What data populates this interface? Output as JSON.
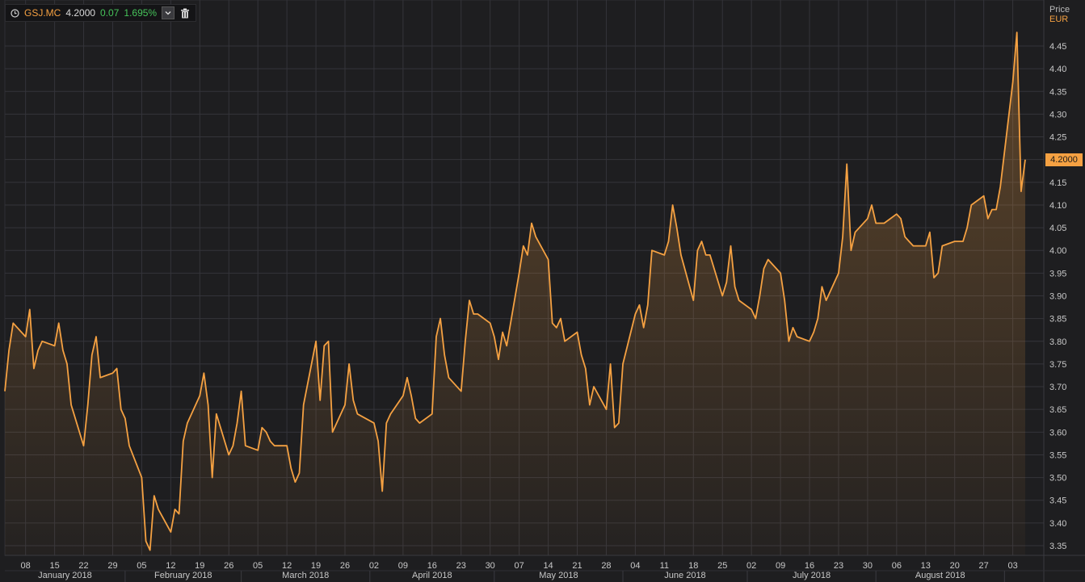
{
  "header": {
    "ticker": "GSJ.MC",
    "price": "4.2000",
    "change": "0.07",
    "change_pct": "1.695%"
  },
  "axis": {
    "price_title": "Price",
    "currency": "EUR",
    "last_price_tag": "4.2000"
  },
  "colors": {
    "background": "#1e1e20",
    "grid": "#34343a",
    "line": "#f5a142",
    "positive": "#46c45a",
    "axis_text": "#c8c8c8"
  },
  "icons": {
    "clock": "clock-icon",
    "dropdown": "chevron-down-icon",
    "delete": "trash-icon"
  },
  "chart_data": {
    "type": "area",
    "title": "",
    "xlabel": "",
    "ylabel": "Price",
    "unit": "EUR",
    "ylim": [
      3.33,
      4.5
    ],
    "yticks": [
      "3.35",
      "3.40",
      "3.45",
      "3.50",
      "3.55",
      "3.60",
      "3.65",
      "3.70",
      "3.75",
      "3.80",
      "3.85",
      "3.90",
      "3.95",
      "4.00",
      "4.05",
      "4.10",
      "4.15",
      "4.20",
      "4.25",
      "4.30",
      "4.35",
      "4.40",
      "4.45"
    ],
    "xlim": [
      "2018-01-03",
      "2018-08-07"
    ],
    "grid": true,
    "x_tick_labels": [
      {
        "date": "2018-01-08",
        "label": "08"
      },
      {
        "date": "2018-01-15",
        "label": "15"
      },
      {
        "date": "2018-01-22",
        "label": "22"
      },
      {
        "date": "2018-01-29",
        "label": "29"
      },
      {
        "date": "2018-02-05",
        "label": "05"
      },
      {
        "date": "2018-02-12",
        "label": "12"
      },
      {
        "date": "2018-02-19",
        "label": "19"
      },
      {
        "date": "2018-02-26",
        "label": "26"
      },
      {
        "date": "2018-03-05",
        "label": "05"
      },
      {
        "date": "2018-03-12",
        "label": "12"
      },
      {
        "date": "2018-03-19",
        "label": "19"
      },
      {
        "date": "2018-03-26",
        "label": "26"
      },
      {
        "date": "2018-04-02",
        "label": "02"
      },
      {
        "date": "2018-04-09",
        "label": "09"
      },
      {
        "date": "2018-04-16",
        "label": "16"
      },
      {
        "date": "2018-04-23",
        "label": "23"
      },
      {
        "date": "2018-04-30",
        "label": "30"
      },
      {
        "date": "2018-05-07",
        "label": "07"
      },
      {
        "date": "2018-05-14",
        "label": "14"
      },
      {
        "date": "2018-05-21",
        "label": "21"
      },
      {
        "date": "2018-05-28",
        "label": "28"
      },
      {
        "date": "2018-06-04",
        "label": "04"
      },
      {
        "date": "2018-06-11",
        "label": "11"
      },
      {
        "date": "2018-06-18",
        "label": "18"
      },
      {
        "date": "2018-06-25",
        "label": "25"
      },
      {
        "date": "2018-07-02",
        "label": "02"
      },
      {
        "date": "2018-07-09",
        "label": "09"
      },
      {
        "date": "2018-07-16",
        "label": "16"
      },
      {
        "date": "2018-07-23",
        "label": "23"
      },
      {
        "date": "2018-07-30",
        "label": "30"
      },
      {
        "date": "2018-08-06",
        "label": "06"
      },
      {
        "date": "2018-08-13",
        "label": "13"
      },
      {
        "date": "2018-08-20",
        "label": "20"
      },
      {
        "date": "2018-08-27",
        "label": "27"
      },
      {
        "date": "2018-09-03",
        "label": "03"
      }
    ],
    "months": [
      {
        "label": "January 2018",
        "start": "2018-01-01"
      },
      {
        "label": "February 2018",
        "start": "2018-02-01"
      },
      {
        "label": "March 2018",
        "start": "2018-03-01"
      },
      {
        "label": "April 2018",
        "start": "2018-04-01"
      },
      {
        "label": "May 2018",
        "start": "2018-05-01"
      },
      {
        "label": "June 2018",
        "start": "2018-06-01"
      },
      {
        "label": "July 2018",
        "start": "2018-07-01"
      },
      {
        "label": "August 2018",
        "start": "2018-08-01"
      },
      {
        "label": "",
        "start": "2018-09-01"
      }
    ],
    "series": [
      {
        "values": [
          [
            "2018-01-03",
            3.69
          ],
          [
            "2018-01-04",
            3.78
          ],
          [
            "2018-01-05",
            3.84
          ],
          [
            "2018-01-08",
            3.81
          ],
          [
            "2018-01-09",
            3.87
          ],
          [
            "2018-01-10",
            3.74
          ],
          [
            "2018-01-11",
            3.78
          ],
          [
            "2018-01-12",
            3.8
          ],
          [
            "2018-01-15",
            3.79
          ],
          [
            "2018-01-16",
            3.84
          ],
          [
            "2018-01-17",
            3.78
          ],
          [
            "2018-01-18",
            3.75
          ],
          [
            "2018-01-19",
            3.66
          ],
          [
            "2018-01-22",
            3.57
          ],
          [
            "2018-01-23",
            3.66
          ],
          [
            "2018-01-24",
            3.77
          ],
          [
            "2018-01-25",
            3.81
          ],
          [
            "2018-01-26",
            3.72
          ],
          [
            "2018-01-29",
            3.73
          ],
          [
            "2018-01-30",
            3.74
          ],
          [
            "2018-01-31",
            3.65
          ],
          [
            "2018-02-01",
            3.63
          ],
          [
            "2018-02-02",
            3.57
          ],
          [
            "2018-02-05",
            3.5
          ],
          [
            "2018-02-06",
            3.36
          ],
          [
            "2018-02-07",
            3.34
          ],
          [
            "2018-02-08",
            3.46
          ],
          [
            "2018-02-09",
            3.43
          ],
          [
            "2018-02-12",
            3.38
          ],
          [
            "2018-02-13",
            3.43
          ],
          [
            "2018-02-14",
            3.42
          ],
          [
            "2018-02-15",
            3.58
          ],
          [
            "2018-02-16",
            3.62
          ],
          [
            "2018-02-19",
            3.68
          ],
          [
            "2018-02-20",
            3.73
          ],
          [
            "2018-02-21",
            3.66
          ],
          [
            "2018-02-22",
            3.5
          ],
          [
            "2018-02-23",
            3.64
          ],
          [
            "2018-02-26",
            3.55
          ],
          [
            "2018-02-27",
            3.57
          ],
          [
            "2018-02-28",
            3.62
          ],
          [
            "2018-03-01",
            3.69
          ],
          [
            "2018-03-02",
            3.57
          ],
          [
            "2018-03-05",
            3.56
          ],
          [
            "2018-03-06",
            3.61
          ],
          [
            "2018-03-07",
            3.6
          ],
          [
            "2018-03-08",
            3.58
          ],
          [
            "2018-03-09",
            3.57
          ],
          [
            "2018-03-12",
            3.57
          ],
          [
            "2018-03-13",
            3.52
          ],
          [
            "2018-03-14",
            3.49
          ],
          [
            "2018-03-15",
            3.51
          ],
          [
            "2018-03-16",
            3.66
          ],
          [
            "2018-03-19",
            3.8
          ],
          [
            "2018-03-20",
            3.67
          ],
          [
            "2018-03-21",
            3.79
          ],
          [
            "2018-03-22",
            3.8
          ],
          [
            "2018-03-23",
            3.6
          ],
          [
            "2018-03-26",
            3.66
          ],
          [
            "2018-03-27",
            3.75
          ],
          [
            "2018-03-28",
            3.67
          ],
          [
            "2018-03-29",
            3.64
          ],
          [
            "2018-04-02",
            3.62
          ],
          [
            "2018-04-03",
            3.58
          ],
          [
            "2018-04-04",
            3.47
          ],
          [
            "2018-04-05",
            3.62
          ],
          [
            "2018-04-06",
            3.64
          ],
          [
            "2018-04-09",
            3.68
          ],
          [
            "2018-04-10",
            3.72
          ],
          [
            "2018-04-11",
            3.68
          ],
          [
            "2018-04-12",
            3.63
          ],
          [
            "2018-04-13",
            3.62
          ],
          [
            "2018-04-16",
            3.64
          ],
          [
            "2018-04-17",
            3.81
          ],
          [
            "2018-04-18",
            3.85
          ],
          [
            "2018-04-19",
            3.77
          ],
          [
            "2018-04-20",
            3.72
          ],
          [
            "2018-04-23",
            3.69
          ],
          [
            "2018-04-24",
            3.8
          ],
          [
            "2018-04-25",
            3.89
          ],
          [
            "2018-04-26",
            3.86
          ],
          [
            "2018-04-27",
            3.86
          ],
          [
            "2018-04-30",
            3.84
          ],
          [
            "2018-05-01",
            3.81
          ],
          [
            "2018-05-02",
            3.76
          ],
          [
            "2018-05-03",
            3.82
          ],
          [
            "2018-05-04",
            3.79
          ],
          [
            "2018-05-07",
            3.95
          ],
          [
            "2018-05-08",
            4.01
          ],
          [
            "2018-05-09",
            3.99
          ],
          [
            "2018-05-10",
            4.06
          ],
          [
            "2018-05-11",
            4.03
          ],
          [
            "2018-05-14",
            3.98
          ],
          [
            "2018-05-15",
            3.84
          ],
          [
            "2018-05-16",
            3.83
          ],
          [
            "2018-05-17",
            3.85
          ],
          [
            "2018-05-18",
            3.8
          ],
          [
            "2018-05-21",
            3.82
          ],
          [
            "2018-05-22",
            3.77
          ],
          [
            "2018-05-23",
            3.74
          ],
          [
            "2018-05-24",
            3.66
          ],
          [
            "2018-05-25",
            3.7
          ],
          [
            "2018-05-28",
            3.65
          ],
          [
            "2018-05-29",
            3.75
          ],
          [
            "2018-05-30",
            3.61
          ],
          [
            "2018-05-31",
            3.62
          ],
          [
            "2018-06-01",
            3.75
          ],
          [
            "2018-06-04",
            3.86
          ],
          [
            "2018-06-05",
            3.88
          ],
          [
            "2018-06-06",
            3.83
          ],
          [
            "2018-06-07",
            3.88
          ],
          [
            "2018-06-08",
            4.0
          ],
          [
            "2018-06-11",
            3.99
          ],
          [
            "2018-06-12",
            4.02
          ],
          [
            "2018-06-13",
            4.1
          ],
          [
            "2018-06-14",
            4.05
          ],
          [
            "2018-06-15",
            3.99
          ],
          [
            "2018-06-18",
            3.89
          ],
          [
            "2018-06-19",
            4.0
          ],
          [
            "2018-06-20",
            4.02
          ],
          [
            "2018-06-21",
            3.99
          ],
          [
            "2018-06-22",
            3.99
          ],
          [
            "2018-06-25",
            3.9
          ],
          [
            "2018-06-26",
            3.93
          ],
          [
            "2018-06-27",
            4.01
          ],
          [
            "2018-06-28",
            3.92
          ],
          [
            "2018-06-29",
            3.89
          ],
          [
            "2018-07-02",
            3.87
          ],
          [
            "2018-07-03",
            3.85
          ],
          [
            "2018-07-04",
            3.9
          ],
          [
            "2018-07-05",
            3.96
          ],
          [
            "2018-07-06",
            3.98
          ],
          [
            "2018-07-09",
            3.95
          ],
          [
            "2018-07-10",
            3.89
          ],
          [
            "2018-07-11",
            3.8
          ],
          [
            "2018-07-12",
            3.83
          ],
          [
            "2018-07-13",
            3.81
          ],
          [
            "2018-07-16",
            3.8
          ],
          [
            "2018-07-17",
            3.82
          ],
          [
            "2018-07-18",
            3.85
          ],
          [
            "2018-07-19",
            3.92
          ],
          [
            "2018-07-20",
            3.89
          ],
          [
            "2018-07-23",
            3.95
          ],
          [
            "2018-07-24",
            4.03
          ],
          [
            "2018-07-25",
            4.19
          ],
          [
            "2018-07-26",
            4.0
          ],
          [
            "2018-07-27",
            4.04
          ],
          [
            "2018-07-30",
            4.07
          ],
          [
            "2018-07-31",
            4.1
          ],
          [
            "2018-08-01",
            4.06
          ],
          [
            "2018-08-02",
            4.06
          ],
          [
            "2018-08-03",
            4.06
          ],
          [
            "2018-08-06",
            4.08
          ],
          [
            "2018-08-07",
            4.07
          ],
          [
            "2018-08-08",
            4.03
          ],
          [
            "2018-08-09",
            4.02
          ],
          [
            "2018-08-10",
            4.01
          ],
          [
            "2018-08-13",
            4.01
          ],
          [
            "2018-08-14",
            4.04
          ],
          [
            "2018-08-15",
            3.94
          ],
          [
            "2018-08-16",
            3.95
          ],
          [
            "2018-08-17",
            4.01
          ],
          [
            "2018-08-20",
            4.02
          ],
          [
            "2018-08-21",
            4.02
          ],
          [
            "2018-08-22",
            4.02
          ],
          [
            "2018-08-23",
            4.05
          ],
          [
            "2018-08-24",
            4.1
          ],
          [
            "2018-08-27",
            4.12
          ],
          [
            "2018-08-28",
            4.07
          ],
          [
            "2018-08-29",
            4.09
          ],
          [
            "2018-08-30",
            4.09
          ],
          [
            "2018-08-31",
            4.14
          ],
          [
            "2018-09-03",
            4.37
          ],
          [
            "2018-09-04",
            4.48
          ],
          [
            "2018-09-05",
            4.13
          ],
          [
            "2018-09-06",
            4.2
          ]
        ]
      }
    ]
  }
}
